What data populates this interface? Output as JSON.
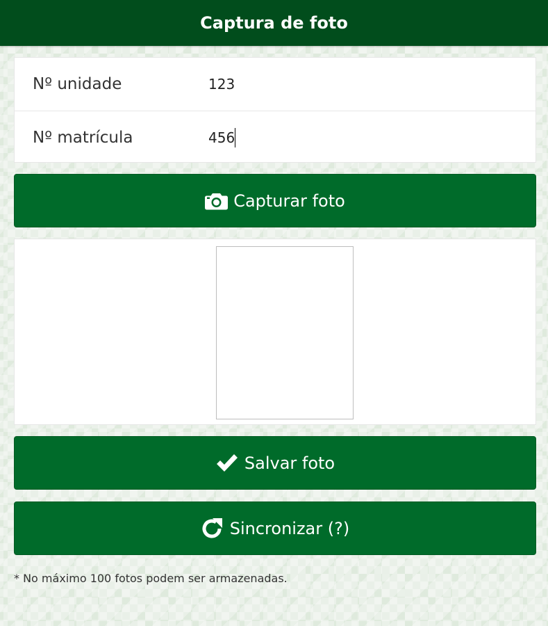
{
  "header": {
    "title": "Captura de foto"
  },
  "form": {
    "unit": {
      "label": "Nº unidade",
      "value": "123"
    },
    "registration": {
      "label": "Nº matrícula",
      "value": "456"
    }
  },
  "buttons": {
    "capture": {
      "label": "Capturar foto",
      "icon": "camera-icon"
    },
    "save": {
      "label": "Salvar foto",
      "icon": "checkmark-icon"
    },
    "sync": {
      "label": "Sincronizar (?)",
      "icon": "refresh-icon"
    }
  },
  "footnote": "* No máximo 100 fotos podem ser armazenadas.",
  "colors": {
    "header": "#014d1c",
    "button": "#006b2a",
    "background": "#e9f0e8"
  }
}
